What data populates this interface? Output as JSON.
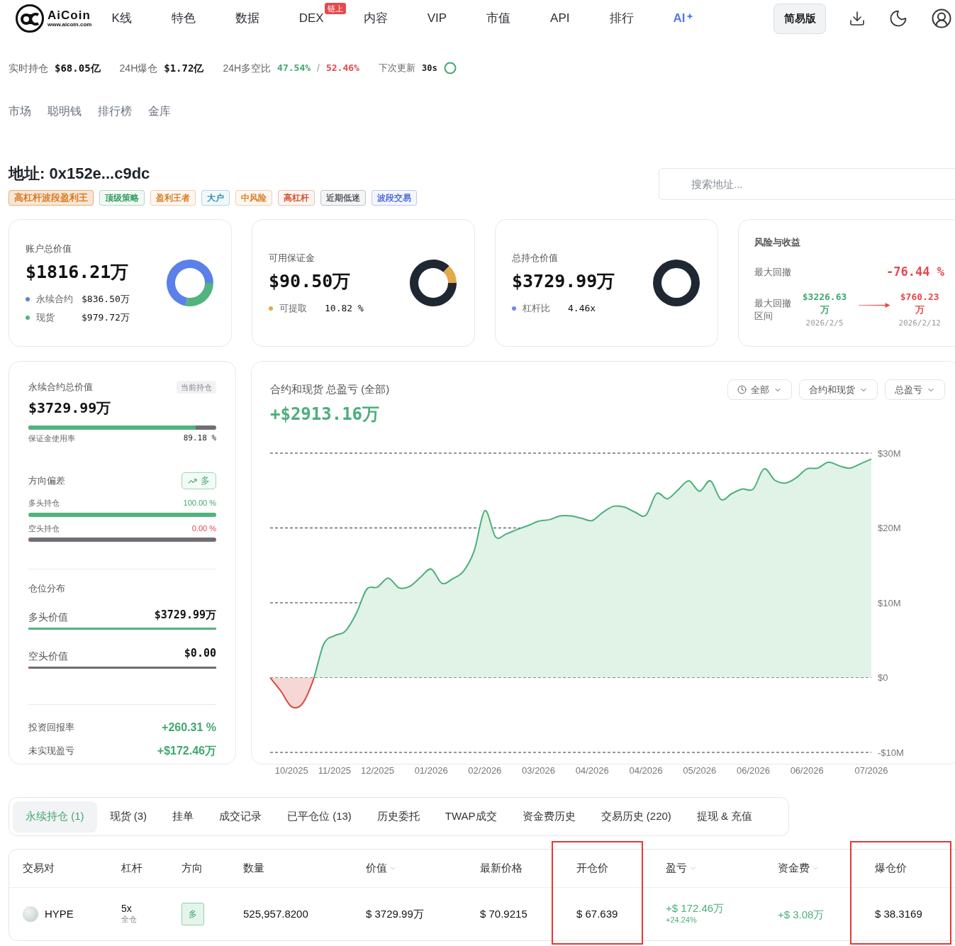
{
  "nav": {
    "logo": {
      "name": "AiCoin",
      "url": "www.aicoin.com"
    },
    "items": [
      {
        "label": "K线",
        "kind": "link"
      },
      {
        "label": "特色",
        "kind": "link"
      },
      {
        "label": "数据",
        "kind": "link"
      },
      {
        "label": "DEX",
        "kind": "link",
        "badge": "链上"
      },
      {
        "label": "内容",
        "kind": "link"
      },
      {
        "label": "VIP",
        "kind": "link"
      },
      {
        "label": "市值",
        "kind": "link"
      },
      {
        "label": "API",
        "kind": "link"
      },
      {
        "label": "排行",
        "kind": "link"
      },
      {
        "label": "AI",
        "kind": "ai"
      }
    ],
    "mode_button": "简易版"
  },
  "stats": [
    {
      "label": "实时持仓",
      "value": "$68.05亿"
    },
    {
      "label": "24H爆仓",
      "value": "$1.72亿"
    }
  ],
  "long_short": {
    "label": "24H多空比",
    "long": "47.54%",
    "separator": "/",
    "short": "52.46%"
  },
  "refresh": {
    "label": "下次更新",
    "value": "30s"
  },
  "sub_nav": [
    "市场",
    "聪明钱",
    "排行榜",
    "金库"
  ],
  "address": {
    "title": "地址: 0x152e...c9dc",
    "tags": [
      {
        "label": "高杠杆波段盈利王",
        "color": "#d97a1f",
        "emphasized": true
      },
      {
        "label": "顶级策略",
        "color": "#2f9a5f",
        "emphasized": false
      },
      {
        "label": "盈利王者",
        "color": "#d97a1f",
        "emphasized": false
      },
      {
        "label": "大户",
        "color": "#2f8fb0",
        "emphasized": false
      },
      {
        "label": "中风险",
        "color": "#d97a1f",
        "emphasized": false
      },
      {
        "label": "高杠杆",
        "color": "#d4502a",
        "emphasized": false
      },
      {
        "label": "近期低迷",
        "color": "#555a61",
        "emphasized": false
      },
      {
        "label": "波段交易",
        "color": "#4a6be0",
        "emphasized": false
      }
    ]
  },
  "search": {
    "placeholder": "搜索地址..."
  },
  "summary_cards": [
    {
      "kind": "donut",
      "label": "账户总价值",
      "value": "$1816.21万",
      "legend": [
        {
          "label": "永续合约",
          "value": "$836.50万",
          "color": "#5b80ea"
        },
        {
          "label": "现货",
          "value": "$979.72万",
          "color": "#52b37f"
        }
      ]
    },
    {
      "kind": "donut",
      "label": "可用保证金",
      "value": "$90.50万",
      "legend": [
        {
          "label": "可提取",
          "value": "10.82 %",
          "color": "#e3a94a"
        }
      ]
    },
    {
      "kind": "donut",
      "label": "总持仓价值",
      "value": "$3729.99万",
      "legend": [
        {
          "label": "杠杆比",
          "value": "4.46x",
          "color": "#6f88ea"
        }
      ]
    },
    {
      "kind": "risk",
      "label": "风险与收益",
      "max_drawdown": {
        "label": "最大回撤",
        "value": "-76.44 %"
      },
      "range": {
        "label": "最大回撤区间",
        "from": {
          "value": "$3226.63万",
          "date": "2026/2/5"
        },
        "to": {
          "value": "$760.23万",
          "date": "2026/2/12"
        }
      }
    }
  ],
  "perp_panel": {
    "title": "永续合约总价值",
    "badge": "当前持仓",
    "value": "$3729.99万",
    "margin": {
      "label": "保证金使用率",
      "value": "89.18 %",
      "level": 0.8918
    },
    "direction": {
      "title": "方向偏差",
      "badge": "多",
      "long": {
        "label": "多头持仓",
        "value": "100.00 %",
        "level": 1
      },
      "short": {
        "label": "空头持仓",
        "value": "0.00 %",
        "level": 0
      }
    },
    "distribution": {
      "title": "仓位分布",
      "long": {
        "label": "多头价值",
        "value": "$3729.99万",
        "level": 1
      },
      "short": {
        "label": "空头价值",
        "value": "$0.00",
        "level": 0
      }
    },
    "returns": [
      {
        "label": "投资回报率",
        "value": "+260.31 %"
      },
      {
        "label": "未实现盈亏",
        "value": "+$172.46万"
      }
    ]
  },
  "pnl_chart": {
    "title": "合约和现货 总盈亏 (全部)",
    "value": "+$2913.16万",
    "filters": [
      {
        "label": "全部",
        "kind": "time"
      },
      {
        "label": "合约和现货",
        "kind": "plain"
      },
      {
        "label": "总盈亏",
        "kind": "plain"
      }
    ],
    "chart_data": {
      "type": "area",
      "grid": true,
      "categories": [
        null,
        null,
        "10/2025",
        null,
        null,
        null,
        "11/2025",
        null,
        null,
        null,
        "12/2025",
        null,
        null,
        null,
        null,
        "01/2026",
        null,
        null,
        null,
        null,
        "02/2026",
        null,
        null,
        null,
        null,
        "03/2026",
        null,
        null,
        null,
        null,
        "04/2026",
        null,
        null,
        null,
        null,
        "04/2026",
        null,
        null,
        null,
        null,
        "05/2026",
        null,
        null,
        null,
        null,
        "06/2026",
        null,
        null,
        null,
        null,
        "06/2026",
        null,
        null,
        null,
        null,
        null,
        "07/2026"
      ],
      "series": [
        {
          "color": "#4caf7d",
          "values": [
            0,
            -1.8,
            -3.9,
            -3.5,
            -0.4,
            4.5,
            5.6,
            6.2,
            8.5,
            11.8,
            12.1,
            13.3,
            12.0,
            12.2,
            13.4,
            14.5,
            12.6,
            13.2,
            14.2,
            16.9,
            22.3,
            18.8,
            19.2,
            19.8,
            20.3,
            20.9,
            21.1,
            21.6,
            21.6,
            21.3,
            21.0,
            22.1,
            22.9,
            22.8,
            22.1,
            21.7,
            24.6,
            23.9,
            25.1,
            26.3,
            24.9,
            26.3,
            23.8,
            24.6,
            25.2,
            25.2,
            27.9,
            26.4,
            26.0,
            26.7,
            27.9,
            28.0,
            28.8,
            28.3,
            28.0,
            28.6,
            29.2
          ]
        }
      ],
      "ylim": [
        -10,
        30
      ],
      "yticks": [
        {
          "value": 30,
          "label": "$30M"
        },
        {
          "value": 20,
          "label": "$20M"
        },
        {
          "value": 10,
          "label": "$10M"
        },
        {
          "value": 0,
          "label": "$0"
        },
        {
          "value": -10,
          "label": "-$10M"
        }
      ]
    }
  },
  "position_tabs": [
    {
      "label": "永续持仓 (1)",
      "selected": true
    },
    {
      "label": "现货 (3)",
      "selected": false
    },
    {
      "label": "挂单",
      "selected": false
    },
    {
      "label": "成交记录",
      "selected": false
    },
    {
      "label": "已平仓位 (13)",
      "selected": false
    },
    {
      "label": "历史委托",
      "selected": false
    },
    {
      "label": "TWAP成交",
      "selected": false
    },
    {
      "label": "资金费历史",
      "selected": false
    },
    {
      "label": "交易历史 (220)",
      "selected": false
    },
    {
      "label": "提现 & 充值",
      "selected": false
    }
  ],
  "positions": {
    "columns": [
      {
        "label": "交易对",
        "sortable": false,
        "highlighted": false
      },
      {
        "label": "杠杆",
        "sortable": false,
        "highlighted": false
      },
      {
        "label": "方向",
        "sortable": false,
        "highlighted": false
      },
      {
        "label": "数量",
        "sortable": false,
        "highlighted": false
      },
      {
        "label": "价值",
        "sortable": true,
        "highlighted": false
      },
      {
        "label": "最新价格",
        "sortable": false,
        "highlighted": false
      },
      {
        "label": "开仓价",
        "sortable": false,
        "highlighted": true
      },
      {
        "label": "盈亏",
        "sortable": true,
        "highlighted": false
      },
      {
        "label": "资金费",
        "sortable": true,
        "highlighted": false
      },
      {
        "label": "爆仓价",
        "sortable": false,
        "highlighted": true
      }
    ],
    "rows": [
      {
        "cells": [
          {
            "kind": "coin",
            "text": "HYPE"
          },
          {
            "kind": "stacked",
            "text": "5x",
            "sub": "全仓"
          },
          {
            "kind": "side",
            "text": "多"
          },
          {
            "kind": "plain",
            "text": "525,957.8200"
          },
          {
            "kind": "plain",
            "text": "$ 3729.99万"
          },
          {
            "kind": "plain",
            "text": "$ 70.9215"
          },
          {
            "kind": "plain",
            "text": "$ 67.639"
          },
          {
            "kind": "gain",
            "text": "+$ 172.46万",
            "sub": "+24.24%"
          },
          {
            "kind": "gain",
            "text": "+$ 3.08万"
          },
          {
            "kind": "plain",
            "text": "$ 38.3169"
          }
        ]
      }
    ]
  }
}
